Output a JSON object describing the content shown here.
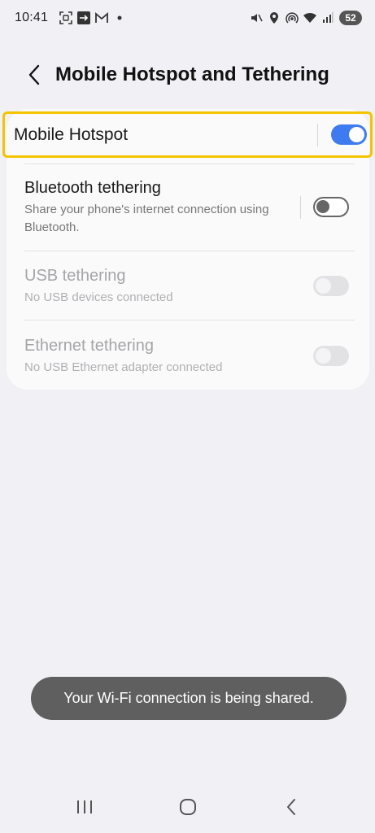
{
  "status_bar": {
    "time": "10:41",
    "battery": "52",
    "left_icons": [
      "screenshot-icon",
      "cast-icon",
      "gmail-icon",
      "dot-icon"
    ],
    "right_icons": [
      "mute-icon",
      "location-icon",
      "hotspot-icon",
      "wifi-icon",
      "signal-icon"
    ]
  },
  "header": {
    "title": "Mobile Hotspot and Tethering"
  },
  "settings": {
    "mobile_hotspot": {
      "label": "Mobile Hotspot",
      "enabled": true
    },
    "bluetooth": {
      "label": "Bluetooth tethering",
      "description": "Share your phone's internet connection using Bluetooth.",
      "enabled": false
    },
    "usb": {
      "label": "USB tethering",
      "description": "No USB devices connected",
      "enabled": false,
      "available": false
    },
    "ethernet": {
      "label": "Ethernet tethering",
      "description": "No USB Ethernet adapter connected",
      "enabled": false,
      "available": false
    }
  },
  "toast": {
    "message": "Your Wi-Fi connection is being shared."
  },
  "colors": {
    "accent": "#3e7bf0",
    "highlight": "#f5c400",
    "background": "#f1f0f5",
    "card": "#fafafb"
  }
}
